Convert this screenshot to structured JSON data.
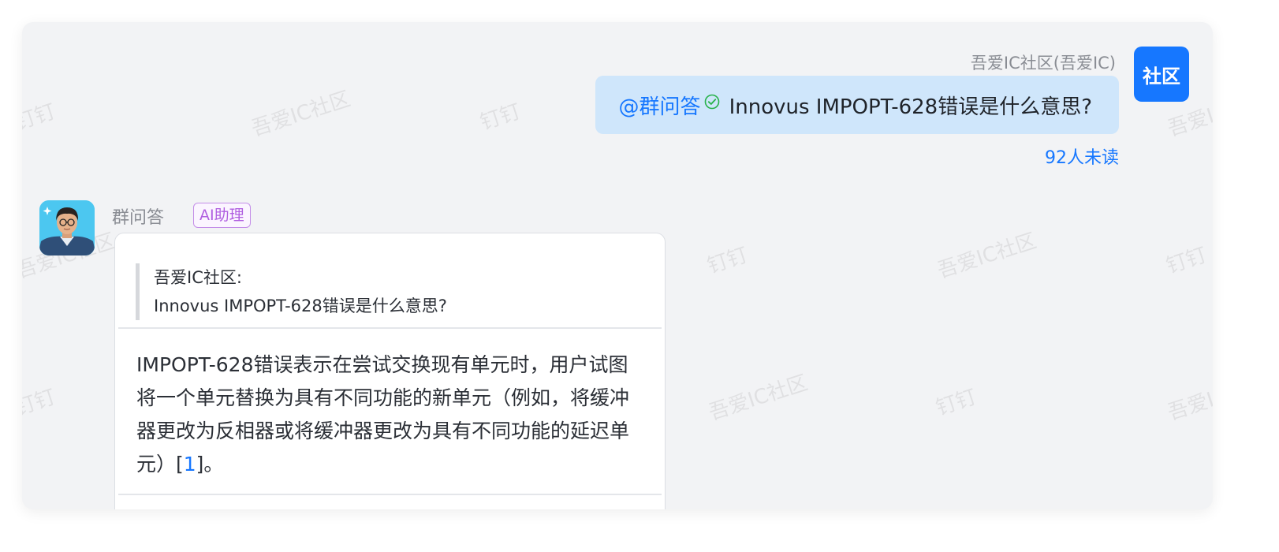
{
  "watermarks": [
    "钉钉",
    "吾爱IC社区"
  ],
  "outgoing": {
    "sender_name": "吾爱IC社区(吾爱IC)",
    "avatar_text": "社区",
    "mention": "@群问答",
    "text": "Innovus  IMPOPT-628错误是什么意思?",
    "unread": "92人未读"
  },
  "incoming": {
    "bot_name": "群问答",
    "badge": "AI助理",
    "quote": {
      "author": "吾爱IC社区:",
      "text": "Innovus  IMPOPT-628错误是什么意思?"
    },
    "answer": {
      "text": "IMPOPT-628错误表示在尝试交换现有单元时，用户试图将一个单元替换为具有不同功能的新单元（例如，将缓冲器更改为反相器或将缓冲器更改为具有不同功能的延迟单元）[",
      "ref": "1",
      "tail": "]。"
    }
  },
  "colors": {
    "accent": "#1677ff",
    "bubble_out": "#cfe6fb",
    "badge": "#b05fe0",
    "verified": "#27b24a"
  },
  "icons": {
    "verified": "check-circle-icon",
    "bot_avatar": "bot-avatar"
  }
}
